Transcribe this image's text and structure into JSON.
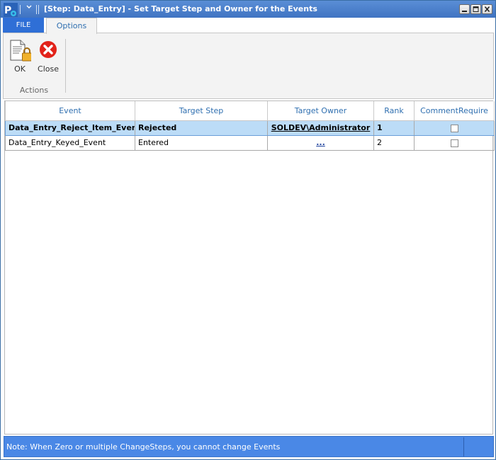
{
  "window": {
    "title": "[Step: Data_Entry] - Set Target Step and Owner for the Events",
    "app_icon": "app-icon",
    "controls": [
      "minimize-icon",
      "maximize-icon",
      "close-icon"
    ]
  },
  "tabs": {
    "file_label": "FILE",
    "options_label": "Options"
  },
  "ribbon": {
    "ok_label": "OK",
    "close_label": "Close",
    "group_label": "Actions"
  },
  "grid": {
    "columns": [
      "Event",
      "Target Step",
      "Target Owner",
      "Rank",
      "CommentRequire"
    ],
    "rows": [
      {
        "event": "Data_Entry_Reject_Item_Event",
        "target_step": "Rejected",
        "target_owner": "SOLDEV\\Administrator",
        "rank": "1",
        "comment_required": false,
        "selected": true
      },
      {
        "event": "Data_Entry_Keyed_Event",
        "target_step": "Entered",
        "target_owner": "...",
        "rank": "2",
        "comment_required": false,
        "selected": false
      }
    ]
  },
  "status": {
    "note": "Note: When Zero or multiple ChangeSteps, you cannot change Events"
  },
  "colors": {
    "titlebar": "#3f73c2",
    "file_tab": "#2f6fd6",
    "statusbar": "#4a88e6",
    "selected_row": "#bcdcf7",
    "header_text": "#2f6fb0"
  }
}
